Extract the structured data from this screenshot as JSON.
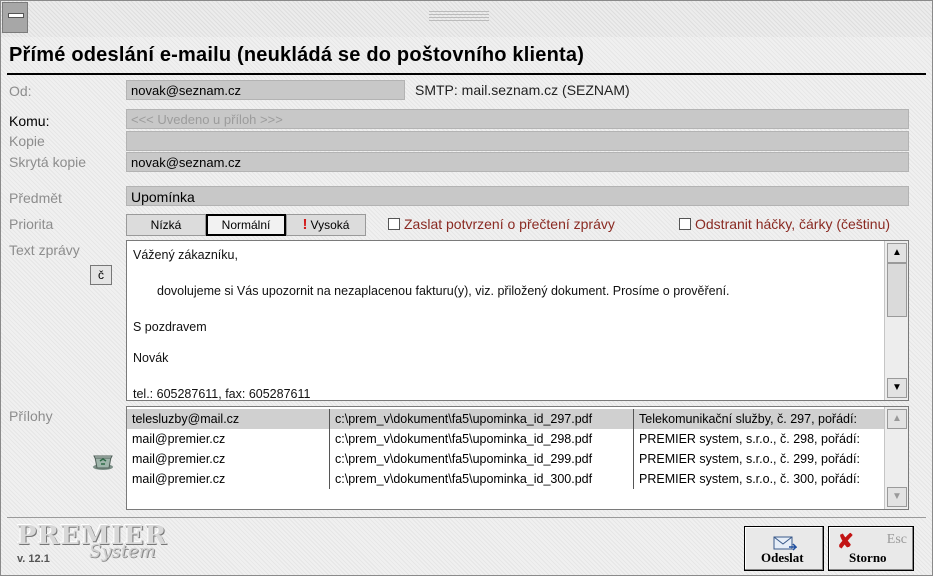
{
  "heading": "Přímé odeslání e-mailu (neukládá se do poštovního klienta)",
  "from": {
    "label": "Od:",
    "value": "novak@seznam.cz",
    "smtp": "SMTP: mail.seznam.cz (SEZNAM)"
  },
  "to": {
    "label": "Komu:",
    "placeholder": "<<< Uvedeno u příloh >>>"
  },
  "cc": {
    "label": "Kopie",
    "value": ""
  },
  "bcc": {
    "label": "Skrytá kopie",
    "value": "novak@seznam.cz"
  },
  "subject": {
    "label": "Předmět",
    "value": "Upomínka"
  },
  "priority": {
    "label": "Priorita",
    "low": "Nízká",
    "normal": "Normální",
    "high": "Vysoká",
    "selected": "normal"
  },
  "options": {
    "read_receipt": "Zaslat potvrzení o přečtení zprávy",
    "strip_diacritics": "Odstranit háčky, čárky (češtinu)"
  },
  "body": {
    "label": "Text zprávy",
    "charset_button": "č",
    "lines": [
      "Vážený zákazníku,",
      "dovolujeme si Vás upozornit na nezaplacenou fakturu(y), viz. přiložený dokument. Prosíme o prověření.",
      "S pozdravem",
      "Novák",
      "tel.: 605287611, fax: 605287611"
    ]
  },
  "attachments": {
    "label": "Přílohy",
    "rows": [
      {
        "email": "telesluzby@mail.cz",
        "file": "c:\\prem_v\\dokument\\fa5\\upominka_id_297.pdf",
        "desc": "Telekomunikační služby, č. 297, pořádí:"
      },
      {
        "email": "mail@premier.cz",
        "file": "c:\\prem_v\\dokument\\fa5\\upominka_id_298.pdf",
        "desc": "PREMIER system, s.r.o., č. 298, pořádí:"
      },
      {
        "email": "mail@premier.cz",
        "file": "c:\\prem_v\\dokument\\fa5\\upominka_id_299.pdf",
        "desc": "PREMIER system, s.r.o., č. 299, pořádí:"
      },
      {
        "email": "mail@premier.cz",
        "file": "c:\\prem_v\\dokument\\fa5\\upominka_id_300.pdf",
        "desc": "PREMIER system, s.r.o., č. 300, pořádí:"
      }
    ]
  },
  "footer": {
    "logo": "PREMIER",
    "logo_sub": "System",
    "version": "v. 12.1",
    "send": "Odeslat",
    "cancel": "Storno",
    "cancel_key": "Esc"
  },
  "colors": {
    "accent_red": "#d21a1a",
    "option_text": "#8a2a22"
  }
}
